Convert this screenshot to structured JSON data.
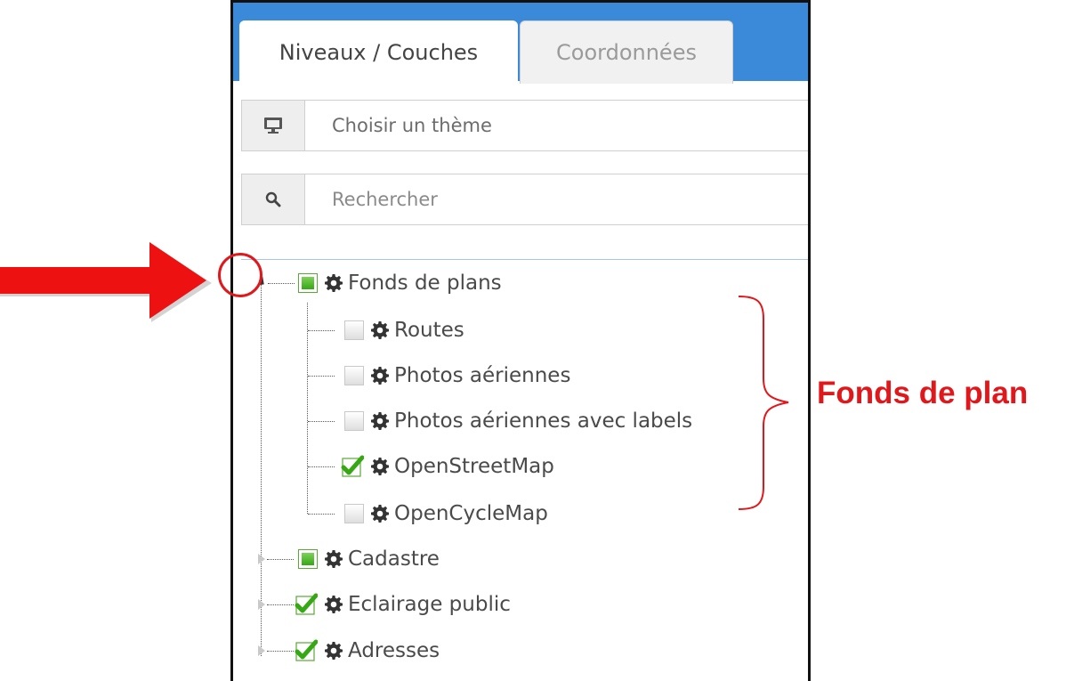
{
  "tabs": {
    "layers": "Niveaux / Couches",
    "coords": "Coordonnées"
  },
  "theme": {
    "placeholder": "Choisir un thème",
    "icon": "monitor-icon"
  },
  "search": {
    "placeholder": "Rechercher",
    "icon": "search-icon"
  },
  "tree": {
    "groups": [
      {
        "label": "Fonds de plans",
        "state": "partial",
        "expanded": true,
        "children": [
          {
            "label": "Routes",
            "state": "unchecked"
          },
          {
            "label": "Photos aériennes",
            "state": "unchecked"
          },
          {
            "label": "Photos aériennes avec labels",
            "state": "unchecked"
          },
          {
            "label": "OpenStreetMap",
            "state": "checked"
          },
          {
            "label": "OpenCycleMap",
            "state": "unchecked"
          }
        ]
      },
      {
        "label": "Cadastre",
        "state": "partial",
        "expanded": false
      },
      {
        "label": "Eclairage public",
        "state": "checked",
        "expanded": false
      },
      {
        "label": "Adresses",
        "state": "checked",
        "expanded": false
      }
    ]
  },
  "annotation": {
    "label": "Fonds de plan",
    "color": "#e0171b"
  },
  "colors": {
    "header": "#3b8ad9",
    "check_green": "#35a814"
  }
}
